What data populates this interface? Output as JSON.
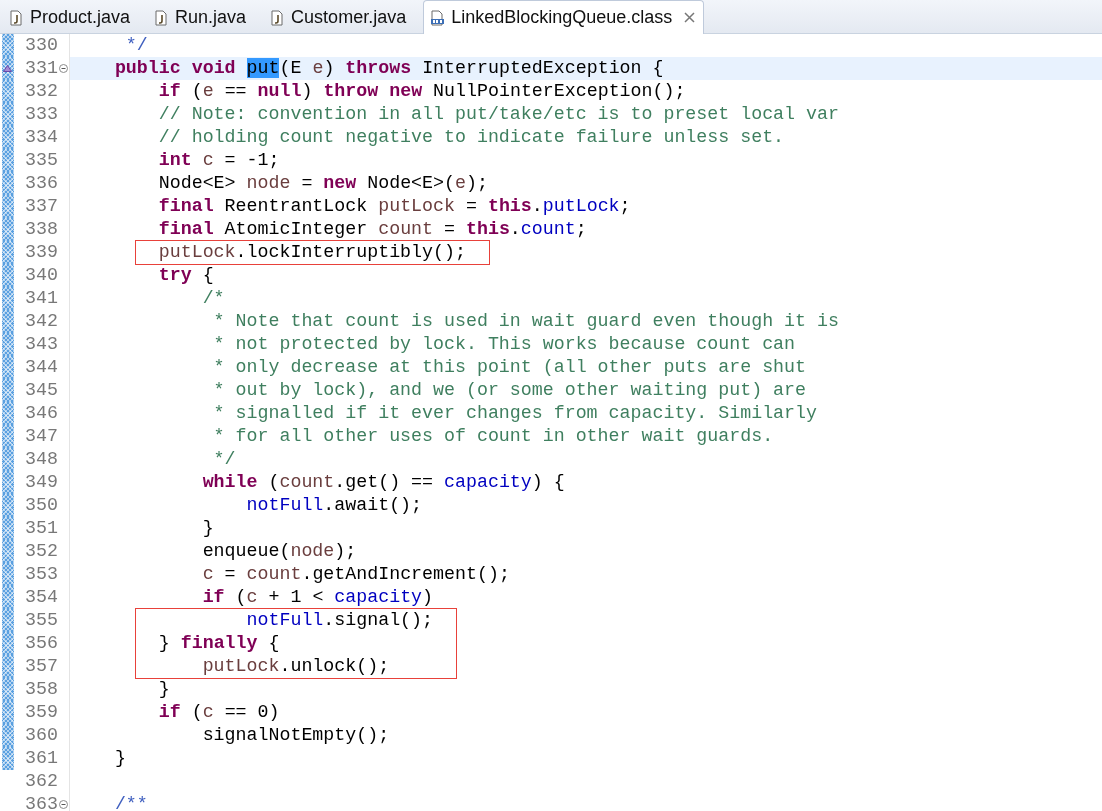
{
  "tabs": [
    {
      "label": "Product.java",
      "kind": "java",
      "selected": false
    },
    {
      "label": "Run.java",
      "kind": "java",
      "selected": false
    },
    {
      "label": "Customer.java",
      "kind": "java",
      "selected": false
    },
    {
      "label": "LinkedBlockingQueue.class",
      "kind": "class",
      "selected": true
    }
  ],
  "editor": {
    "lines": [
      {
        "number": "330",
        "current": false,
        "fold": false,
        "override": false,
        "changed": true,
        "boxed": false,
        "tokens": [
          {
            "kind": "javadoc",
            "text": "     */"
          }
        ]
      },
      {
        "number": "331",
        "current": true,
        "fold": true,
        "override": true,
        "changed": true,
        "boxed": false,
        "tokens": [
          {
            "kind": "keyword",
            "text": "    public"
          },
          {
            "kind": "keyword",
            "text": " void "
          },
          {
            "kind": "selection",
            "text": "put"
          },
          {
            "kind": "plain",
            "text": "(E "
          },
          {
            "kind": "local",
            "text": "e"
          },
          {
            "kind": "plain",
            "text": ") "
          },
          {
            "kind": "keyword",
            "text": "throws"
          },
          {
            "kind": "plain",
            "text": " InterruptedException {"
          }
        ]
      },
      {
        "number": "332",
        "current": false,
        "fold": false,
        "override": false,
        "changed": true,
        "boxed": false,
        "tokens": [
          {
            "kind": "keyword",
            "text": "        if"
          },
          {
            "kind": "plain",
            "text": " ("
          },
          {
            "kind": "local",
            "text": "e"
          },
          {
            "kind": "plain",
            "text": " == "
          },
          {
            "kind": "keyword",
            "text": "null"
          },
          {
            "kind": "plain",
            "text": ") "
          },
          {
            "kind": "keyword",
            "text": "throw"
          },
          {
            "kind": "keyword",
            "text": " new"
          },
          {
            "kind": "plain",
            "text": " NullPointerException();"
          }
        ]
      },
      {
        "number": "333",
        "current": false,
        "fold": false,
        "override": false,
        "changed": true,
        "boxed": false,
        "tokens": [
          {
            "kind": "comment",
            "text": "        // Note: convention in all put/take/etc is to preset local var"
          }
        ]
      },
      {
        "number": "334",
        "current": false,
        "fold": false,
        "override": false,
        "changed": true,
        "boxed": false,
        "tokens": [
          {
            "kind": "comment",
            "text": "        // holding count negative to indicate failure unless set."
          }
        ]
      },
      {
        "number": "335",
        "current": false,
        "fold": false,
        "override": false,
        "changed": true,
        "boxed": false,
        "tokens": [
          {
            "kind": "keyword",
            "text": "        int"
          },
          {
            "kind": "local",
            "text": " c"
          },
          {
            "kind": "plain",
            "text": " = -1;"
          }
        ]
      },
      {
        "number": "336",
        "current": false,
        "fold": false,
        "override": false,
        "changed": true,
        "boxed": false,
        "tokens": [
          {
            "kind": "plain",
            "text": "        Node<E> "
          },
          {
            "kind": "local",
            "text": "node"
          },
          {
            "kind": "plain",
            "text": " = "
          },
          {
            "kind": "keyword",
            "text": "new"
          },
          {
            "kind": "plain",
            "text": " Node<E>("
          },
          {
            "kind": "local",
            "text": "e"
          },
          {
            "kind": "plain",
            "text": ");"
          }
        ]
      },
      {
        "number": "337",
        "current": false,
        "fold": false,
        "override": false,
        "changed": true,
        "boxed": false,
        "tokens": [
          {
            "kind": "keyword",
            "text": "        final"
          },
          {
            "kind": "plain",
            "text": " ReentrantLock "
          },
          {
            "kind": "local",
            "text": "putLock"
          },
          {
            "kind": "plain",
            "text": " = "
          },
          {
            "kind": "keyword",
            "text": "this"
          },
          {
            "kind": "plain",
            "text": "."
          },
          {
            "kind": "field",
            "text": "putLock"
          },
          {
            "kind": "plain",
            "text": ";"
          }
        ]
      },
      {
        "number": "338",
        "current": false,
        "fold": false,
        "override": false,
        "changed": true,
        "boxed": false,
        "tokens": [
          {
            "kind": "keyword",
            "text": "        final"
          },
          {
            "kind": "plain",
            "text": " AtomicInteger "
          },
          {
            "kind": "local",
            "text": "count"
          },
          {
            "kind": "plain",
            "text": " = "
          },
          {
            "kind": "keyword",
            "text": "this"
          },
          {
            "kind": "plain",
            "text": "."
          },
          {
            "kind": "field",
            "text": "count"
          },
          {
            "kind": "plain",
            "text": ";"
          }
        ]
      },
      {
        "number": "339",
        "current": false,
        "fold": false,
        "override": false,
        "changed": true,
        "boxed": true,
        "tokens": [
          {
            "kind": "local",
            "text": "        putLock"
          },
          {
            "kind": "plain",
            "text": ".lockInterruptibly();"
          }
        ]
      },
      {
        "number": "340",
        "current": false,
        "fold": false,
        "override": false,
        "changed": true,
        "boxed": false,
        "tokens": [
          {
            "kind": "keyword",
            "text": "        try"
          },
          {
            "kind": "plain",
            "text": " {"
          }
        ]
      },
      {
        "number": "341",
        "current": false,
        "fold": false,
        "override": false,
        "changed": true,
        "boxed": false,
        "tokens": [
          {
            "kind": "comment",
            "text": "            /*"
          }
        ]
      },
      {
        "number": "342",
        "current": false,
        "fold": false,
        "override": false,
        "changed": true,
        "boxed": false,
        "tokens": [
          {
            "kind": "comment",
            "text": "             * Note that count is used in wait guard even though it is"
          }
        ]
      },
      {
        "number": "343",
        "current": false,
        "fold": false,
        "override": false,
        "changed": true,
        "boxed": false,
        "tokens": [
          {
            "kind": "comment",
            "text": "             * not protected by lock. This works because count can"
          }
        ]
      },
      {
        "number": "344",
        "current": false,
        "fold": false,
        "override": false,
        "changed": true,
        "boxed": false,
        "tokens": [
          {
            "kind": "comment",
            "text": "             * only decrease at this point (all other puts are shut"
          }
        ]
      },
      {
        "number": "345",
        "current": false,
        "fold": false,
        "override": false,
        "changed": true,
        "boxed": false,
        "tokens": [
          {
            "kind": "comment",
            "text": "             * out by lock), and we (or some other waiting put) are"
          }
        ]
      },
      {
        "number": "346",
        "current": false,
        "fold": false,
        "override": false,
        "changed": true,
        "boxed": false,
        "tokens": [
          {
            "kind": "comment",
            "text": "             * signalled if it ever changes from capacity. Similarly"
          }
        ]
      },
      {
        "number": "347",
        "current": false,
        "fold": false,
        "override": false,
        "changed": true,
        "boxed": false,
        "tokens": [
          {
            "kind": "comment",
            "text": "             * for all other uses of count in other wait guards."
          }
        ]
      },
      {
        "number": "348",
        "current": false,
        "fold": false,
        "override": false,
        "changed": true,
        "boxed": false,
        "tokens": [
          {
            "kind": "comment",
            "text": "             */"
          }
        ]
      },
      {
        "number": "349",
        "current": false,
        "fold": false,
        "override": false,
        "changed": true,
        "boxed": false,
        "tokens": [
          {
            "kind": "keyword",
            "text": "            while"
          },
          {
            "kind": "plain",
            "text": " ("
          },
          {
            "kind": "local",
            "text": "count"
          },
          {
            "kind": "plain",
            "text": ".get() == "
          },
          {
            "kind": "field",
            "text": "capacity"
          },
          {
            "kind": "plain",
            "text": ") {"
          }
        ]
      },
      {
        "number": "350",
        "current": false,
        "fold": false,
        "override": false,
        "changed": true,
        "boxed": false,
        "tokens": [
          {
            "kind": "field",
            "text": "                notFull"
          },
          {
            "kind": "plain",
            "text": ".await();"
          }
        ]
      },
      {
        "number": "351",
        "current": false,
        "fold": false,
        "override": false,
        "changed": true,
        "boxed": false,
        "tokens": [
          {
            "kind": "plain",
            "text": "            }"
          }
        ]
      },
      {
        "number": "352",
        "current": false,
        "fold": false,
        "override": false,
        "changed": true,
        "boxed": false,
        "tokens": [
          {
            "kind": "plain",
            "text": "            enqueue("
          },
          {
            "kind": "local",
            "text": "node"
          },
          {
            "kind": "plain",
            "text": ");"
          }
        ]
      },
      {
        "number": "353",
        "current": false,
        "fold": false,
        "override": false,
        "changed": true,
        "boxed": false,
        "tokens": [
          {
            "kind": "local",
            "text": "            c"
          },
          {
            "kind": "plain",
            "text": " = "
          },
          {
            "kind": "local",
            "text": "count"
          },
          {
            "kind": "plain",
            "text": ".getAndIncrement();"
          }
        ]
      },
      {
        "number": "354",
        "current": false,
        "fold": false,
        "override": false,
        "changed": true,
        "boxed": false,
        "tokens": [
          {
            "kind": "keyword",
            "text": "            if"
          },
          {
            "kind": "plain",
            "text": " ("
          },
          {
            "kind": "local",
            "text": "c"
          },
          {
            "kind": "plain",
            "text": " + 1 < "
          },
          {
            "kind": "field",
            "text": "capacity"
          },
          {
            "kind": "plain",
            "text": ")"
          }
        ]
      },
      {
        "number": "355",
        "current": false,
        "fold": false,
        "override": false,
        "changed": true,
        "boxed": true,
        "tokens": [
          {
            "kind": "field",
            "text": "                notFull"
          },
          {
            "kind": "plain",
            "text": ".signal();"
          }
        ]
      },
      {
        "number": "356",
        "current": false,
        "fold": false,
        "override": false,
        "changed": true,
        "boxed": true,
        "tokens": [
          {
            "kind": "plain",
            "text": "        } "
          },
          {
            "kind": "keyword",
            "text": "finally"
          },
          {
            "kind": "plain",
            "text": " {"
          }
        ]
      },
      {
        "number": "357",
        "current": false,
        "fold": false,
        "override": false,
        "changed": true,
        "boxed": true,
        "tokens": [
          {
            "kind": "local",
            "text": "            putLock"
          },
          {
            "kind": "plain",
            "text": ".unlock();"
          }
        ]
      },
      {
        "number": "358",
        "current": false,
        "fold": false,
        "override": false,
        "changed": true,
        "boxed": false,
        "tokens": [
          {
            "kind": "plain",
            "text": "        }"
          }
        ]
      },
      {
        "number": "359",
        "current": false,
        "fold": false,
        "override": false,
        "changed": true,
        "boxed": false,
        "tokens": [
          {
            "kind": "keyword",
            "text": "        if"
          },
          {
            "kind": "plain",
            "text": " ("
          },
          {
            "kind": "local",
            "text": "c"
          },
          {
            "kind": "plain",
            "text": " == 0)"
          }
        ]
      },
      {
        "number": "360",
        "current": false,
        "fold": false,
        "override": false,
        "changed": true,
        "boxed": false,
        "tokens": [
          {
            "kind": "plain",
            "text": "            signalNotEmpty();"
          }
        ]
      },
      {
        "number": "361",
        "current": false,
        "fold": false,
        "override": false,
        "changed": true,
        "boxed": false,
        "tokens": [
          {
            "kind": "plain",
            "text": "    }"
          }
        ]
      },
      {
        "number": "362",
        "current": false,
        "fold": false,
        "override": false,
        "changed": false,
        "boxed": false
      },
      {
        "number": "363",
        "current": false,
        "fold": true,
        "override": false,
        "changed": false,
        "boxed": false,
        "tokens": [
          {
            "kind": "javadoc",
            "text": "    /**"
          }
        ]
      }
    ]
  }
}
